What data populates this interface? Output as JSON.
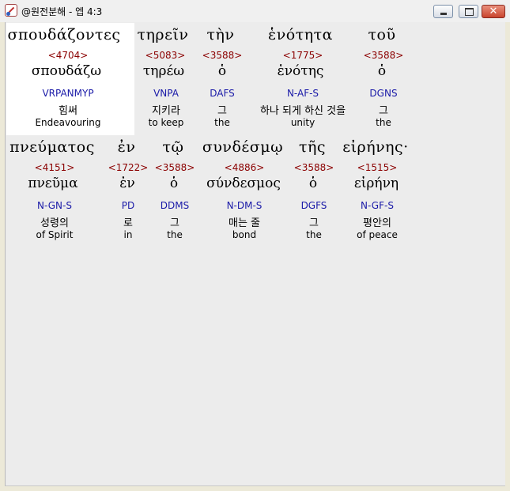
{
  "window": {
    "title": "@원전분해 - 엡 4:3",
    "min_icon": "minimize-icon",
    "max_icon": "maximize-icon",
    "close_glyph": "✕"
  },
  "rows": [
    {
      "words": [
        {
          "greek": "σπουδάζοντες",
          "strong": "<4704>",
          "lemma": "σπουδάζω",
          "parse": "VRPANMYP",
          "korean": "힘써",
          "english": "Endeavouring"
        },
        {
          "greek": "τηρεῖν",
          "strong": "<5083>",
          "lemma": "τηρέω",
          "parse": "VNPA",
          "korean": "지키라",
          "english": "to keep"
        },
        {
          "greek": "τὴν",
          "strong": "<3588>",
          "lemma": "ὁ",
          "parse": "DAFS",
          "korean": "그",
          "english": "the"
        },
        {
          "greek": "ἑνότητα",
          "strong": "<1775>",
          "lemma": "ἑνότης",
          "parse": "N-AF-S",
          "korean": "하나 되게 하신 것을",
          "english": "unity"
        },
        {
          "greek": "τοῦ",
          "strong": "<3588>",
          "lemma": "ὁ",
          "parse": "DGNS",
          "korean": "그",
          "english": "the"
        }
      ]
    },
    {
      "words": [
        {
          "greek": "πνεύματος",
          "strong": "<4151>",
          "lemma": "πνεῦμα",
          "parse": "N-GN-S",
          "korean": "성령의",
          "english": "of Spirit"
        },
        {
          "greek": "ἐν",
          "strong": "<1722>",
          "lemma": "ἐν",
          "parse": "PD",
          "korean": "로",
          "english": "in"
        },
        {
          "greek": "τῷ",
          "strong": "<3588>",
          "lemma": "ὁ",
          "parse": "DDMS",
          "korean": "그",
          "english": "the"
        },
        {
          "greek": "συνδέσμῳ",
          "strong": "<4886>",
          "lemma": "σύνδεσμος",
          "parse": "N-DM-S",
          "korean": "매는 줄",
          "english": "bond"
        },
        {
          "greek": "τῆς",
          "strong": "<3588>",
          "lemma": "ὁ",
          "parse": "DGFS",
          "korean": "그",
          "english": "the"
        },
        {
          "greek": "εἰρήνης·",
          "strong": "<1515>",
          "lemma": "εἰρήνη",
          "parse": "N-GF-S",
          "korean": "평안의",
          "english": "of peace"
        }
      ]
    }
  ]
}
